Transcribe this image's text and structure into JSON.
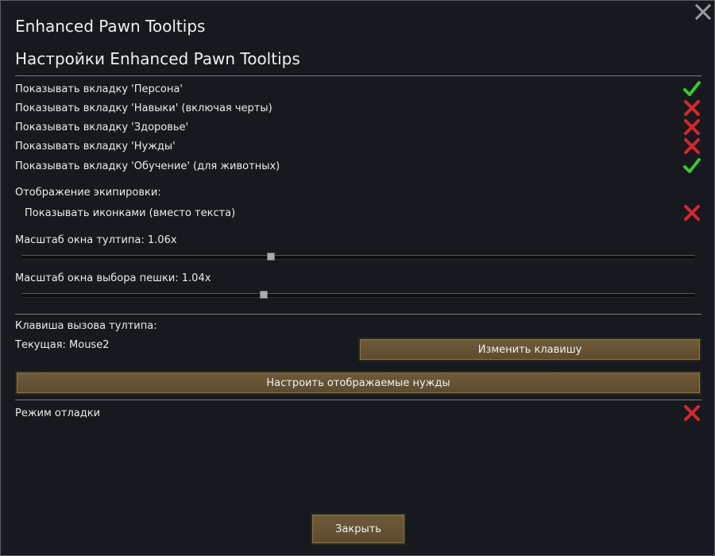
{
  "window": {
    "title": "Enhanced Pawn Tooltips",
    "heading": "Настройки Enhanced Pawn Tooltips"
  },
  "tabs_settings": [
    {
      "label": "Показывать вкладку 'Персона'",
      "enabled": true
    },
    {
      "label": "Показывать вкладку 'Навыки' (включая черты)",
      "enabled": false
    },
    {
      "label": "Показывать вкладку 'Здоровье'",
      "enabled": false
    },
    {
      "label": "Показывать вкладку 'Нужды'",
      "enabled": false
    },
    {
      "label": "Показывать вкладку 'Обучение' (для животных)",
      "enabled": true
    }
  ],
  "equipment": {
    "header": "Отображение экипировки:",
    "icons_label": "Показывать иконками (вместо текста)",
    "icons_enabled": false
  },
  "sliders": {
    "tooltip_scale_label": "Масштаб окна тултипа: 1.06x",
    "tooltip_scale_value": 0.37,
    "pawn_select_scale_label": "Масштаб окна выбора пешки: 1.04x",
    "pawn_select_scale_value": 0.36
  },
  "hotkey": {
    "header": "Клавиша вызова тултипа:",
    "current": "Текущая: Mouse2",
    "change_button": "Изменить клавишу"
  },
  "needs_button": "Настроить отображаемые нужды",
  "debug": {
    "label": "Режим отладки",
    "enabled": false
  },
  "close_button": "Закрыть",
  "colors": {
    "check": "#37c72f",
    "cross": "#d8262a",
    "button": "#6a573a"
  }
}
